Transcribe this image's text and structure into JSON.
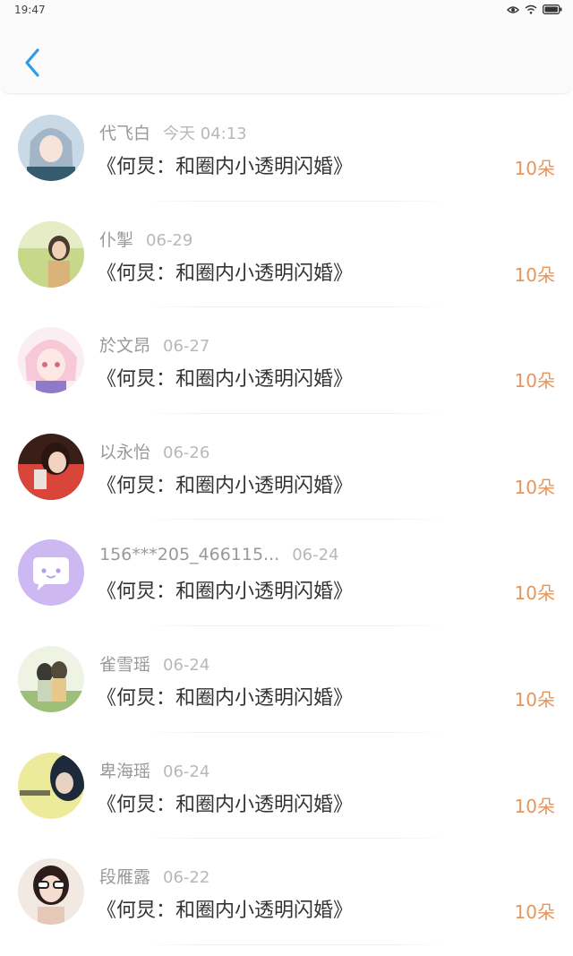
{
  "status_bar": {
    "time": "19:47"
  },
  "colors": {
    "accent_blue": "#2f9be6",
    "flower_orange": "#e8955a",
    "username_gray": "#999999"
  },
  "header": {
    "back_icon": "chevron-left-icon"
  },
  "items": [
    {
      "username": "代飞白",
      "date": "今天 04:13",
      "book": "《何炅：和圈内小透明闪婚》",
      "count": "10朵"
    },
    {
      "username": "仆掣",
      "date": "06-29",
      "book": "《何炅：和圈内小透明闪婚》",
      "count": "10朵"
    },
    {
      "username": "於文昂",
      "date": "06-27",
      "book": "《何炅：和圈内小透明闪婚》",
      "count": "10朵"
    },
    {
      "username": "以永怡",
      "date": "06-26",
      "book": "《何炅：和圈内小透明闪婚》",
      "count": "10朵"
    },
    {
      "username": "156***205_466115...",
      "date": "06-24",
      "book": "《何炅：和圈内小透明闪婚》",
      "count": "10朵"
    },
    {
      "username": "雀雪瑶",
      "date": "06-24",
      "book": "《何炅：和圈内小透明闪婚》",
      "count": "10朵"
    },
    {
      "username": "卑海瑶",
      "date": "06-24",
      "book": "《何炅：和圈内小透明闪婚》",
      "count": "10朵"
    },
    {
      "username": "段雁露",
      "date": "06-22",
      "book": "《何炅：和圈内小透明闪婚》",
      "count": "10朵"
    }
  ]
}
